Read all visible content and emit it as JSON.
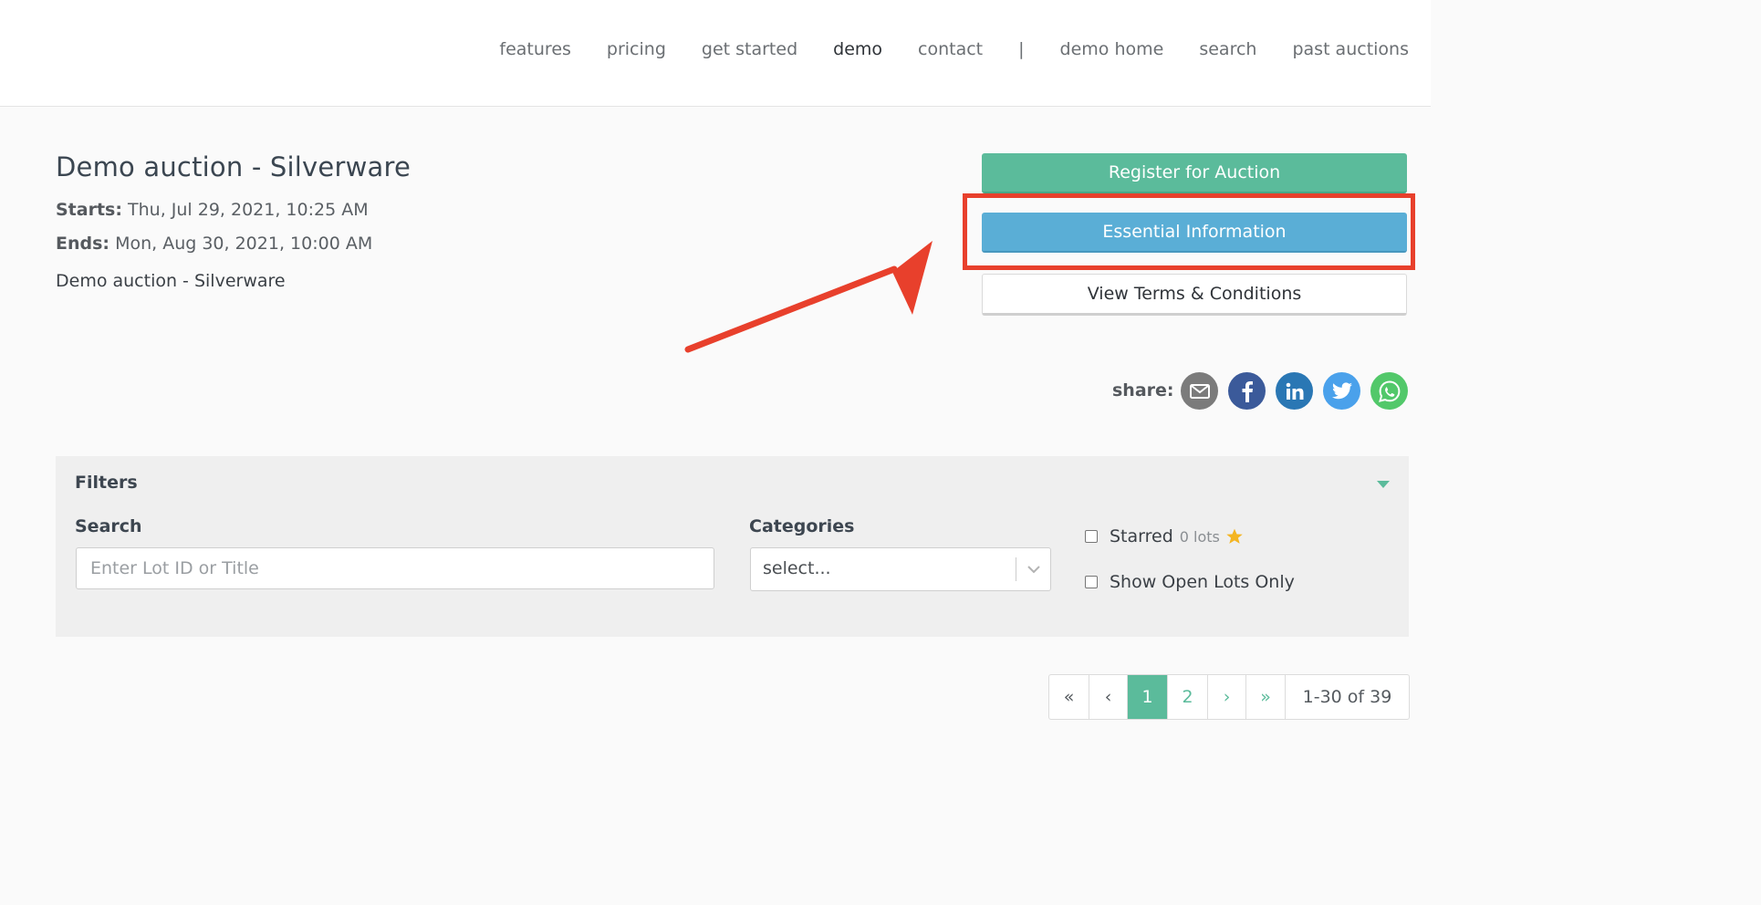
{
  "nav": {
    "items": [
      "features",
      "pricing",
      "get started",
      "demo",
      "contact"
    ],
    "separator": "|",
    "right_items": [
      "demo home",
      "search",
      "past auctions"
    ],
    "active": "demo"
  },
  "auction": {
    "title": "Demo auction - Silverware",
    "starts_label": "Starts:",
    "starts_value": "Thu, Jul 29, 2021, 10:25 AM",
    "ends_label": "Ends:",
    "ends_value": "Mon, Aug 30, 2021, 10:00 AM",
    "description": "Demo auction - Silverware"
  },
  "actions": {
    "register": "Register for Auction",
    "essential": "Essential Information",
    "terms": "View Terms & Conditions"
  },
  "share": {
    "label": "share:",
    "icons": [
      "email-icon",
      "facebook-icon",
      "linkedin-icon",
      "twitter-icon",
      "whatsapp-icon"
    ],
    "colors": {
      "email": "#7b7b7b",
      "facebook": "#3b5a9a",
      "linkedin": "#2a77b4",
      "twitter": "#4aa1eb",
      "whatsapp": "#52c86a"
    }
  },
  "filters": {
    "title": "Filters",
    "search_label": "Search",
    "search_placeholder": "Enter Lot ID or Title",
    "search_value": "",
    "categories_label": "Categories",
    "categories_selected": "select...",
    "starred_label": "Starred",
    "starred_count": "0 lots",
    "open_lots_label": "Show Open Lots Only"
  },
  "pagination": {
    "first": "«",
    "prev": "‹",
    "pages": [
      "1",
      "2"
    ],
    "current": "1",
    "next": "›",
    "last": "»",
    "range": "1-30 of 39"
  },
  "colors": {
    "accent_green": "#5bbb9b",
    "info_blue": "#5aaed6",
    "annotation_red": "#e8402c",
    "star_yellow": "#f4b522"
  }
}
